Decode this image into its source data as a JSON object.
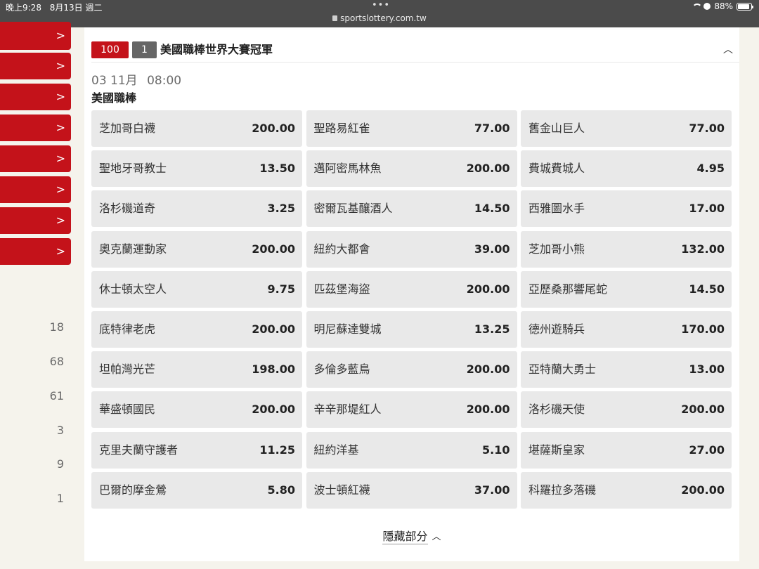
{
  "status_bar": {
    "time": "晚上9:28",
    "date": "8月13日 週二",
    "url": "sportslottery.com.tw",
    "battery": "88%",
    "battery_level": 0.88
  },
  "sidebar": {
    "buttons": [
      ">",
      ">",
      ">",
      ">",
      ">",
      ">",
      ">",
      ">"
    ],
    "numbers": [
      "18",
      "68",
      "61",
      "3",
      "9",
      "1"
    ]
  },
  "event": {
    "id_badge": "100",
    "count_badge": "1",
    "title": "美國職棒世界大賽冠軍",
    "date_day": "03 11月",
    "date_time": "08:00",
    "league": "美國職棒"
  },
  "odds": [
    {
      "team": "芝加哥白襪",
      "odds": "200.00"
    },
    {
      "team": "聖路易紅雀",
      "odds": "77.00"
    },
    {
      "team": "舊金山巨人",
      "odds": "77.00"
    },
    {
      "team": "聖地牙哥教士",
      "odds": "13.50"
    },
    {
      "team": "邁阿密馬林魚",
      "odds": "200.00"
    },
    {
      "team": "費城費城人",
      "odds": "4.95"
    },
    {
      "team": "洛杉磯道奇",
      "odds": "3.25"
    },
    {
      "team": "密爾瓦基釀酒人",
      "odds": "14.50"
    },
    {
      "team": "西雅圖水手",
      "odds": "17.00"
    },
    {
      "team": "奧克蘭運動家",
      "odds": "200.00"
    },
    {
      "team": "紐約大都會",
      "odds": "39.00"
    },
    {
      "team": "芝加哥小熊",
      "odds": "132.00"
    },
    {
      "team": "休士頓太空人",
      "odds": "9.75"
    },
    {
      "team": "匹茲堡海盜",
      "odds": "200.00"
    },
    {
      "team": "亞歷桑那響尾蛇",
      "odds": "14.50"
    },
    {
      "team": "底特律老虎",
      "odds": "200.00"
    },
    {
      "team": "明尼蘇達雙城",
      "odds": "13.25"
    },
    {
      "team": "德州遊騎兵",
      "odds": "170.00"
    },
    {
      "team": "坦帕灣光芒",
      "odds": "198.00"
    },
    {
      "team": "多倫多藍鳥",
      "odds": "200.00"
    },
    {
      "team": "亞特蘭大勇士",
      "odds": "13.00"
    },
    {
      "team": "華盛頓國民",
      "odds": "200.00"
    },
    {
      "team": "辛辛那堤紅人",
      "odds": "200.00"
    },
    {
      "team": "洛杉磯天使",
      "odds": "200.00"
    },
    {
      "team": "克里夫蘭守護者",
      "odds": "11.25"
    },
    {
      "team": "紐約洋基",
      "odds": "5.10"
    },
    {
      "team": "堪薩斯皇家",
      "odds": "27.00"
    },
    {
      "team": "巴爾的摩金鶯",
      "odds": "5.80"
    },
    {
      "team": "波士頓紅襪",
      "odds": "37.00"
    },
    {
      "team": "科羅拉多落磯",
      "odds": "200.00"
    }
  ],
  "footer": {
    "hide_label": "隱藏部分"
  },
  "colors": {
    "brand_red": "#c4121a",
    "cell_bg": "#e9e9e9",
    "page_bg": "#f5f3ec"
  }
}
